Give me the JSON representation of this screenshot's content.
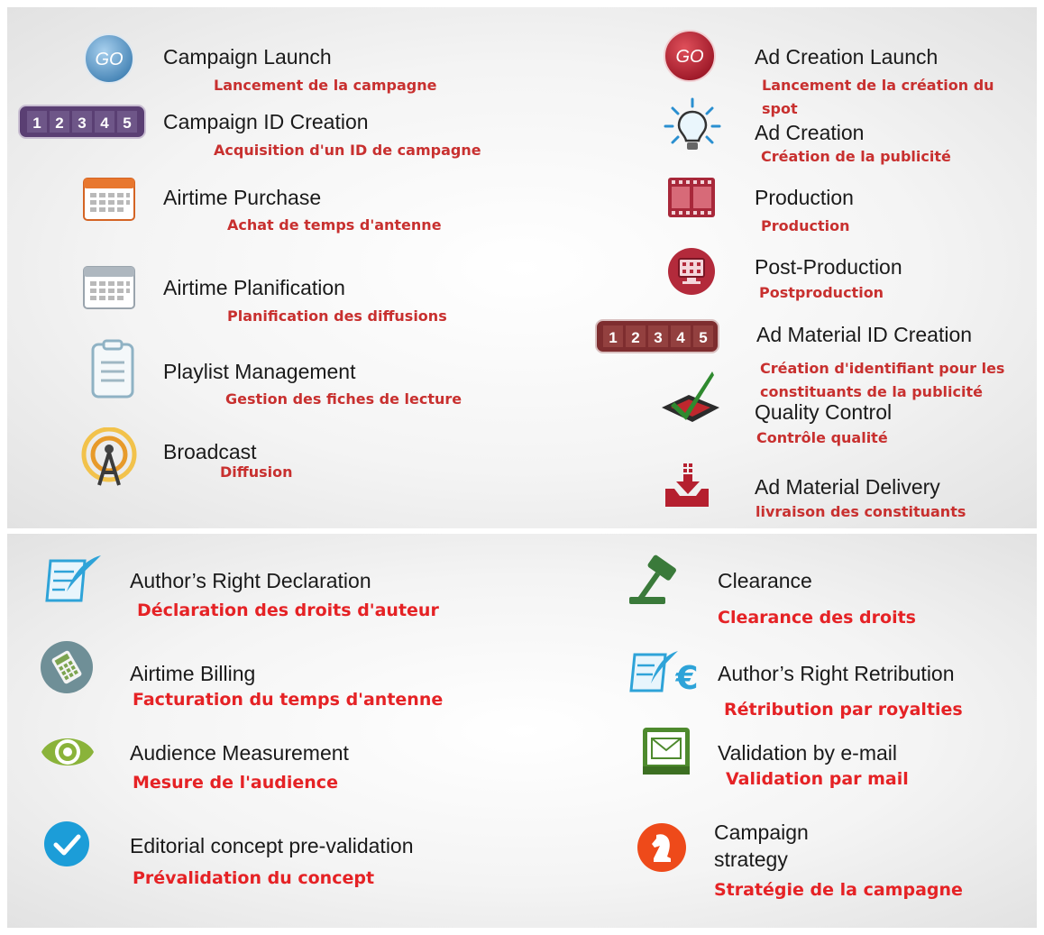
{
  "top_left": [
    {
      "en": "Campaign Launch",
      "fr": "Lancement de la campagne",
      "icon": "go-button-blue-icon"
    },
    {
      "en": "Campaign ID Creation",
      "fr": "Acquisition d'un ID de campagne",
      "icon": "id-counter-purple-icon",
      "digits": "1 2 3 4 5"
    },
    {
      "en": "Airtime Purchase",
      "fr": "Achat de temps d'antenne",
      "icon": "calendar-orange-icon"
    },
    {
      "en": "Airtime Planification",
      "fr": "Planification des diffusions",
      "icon": "calendar-grey-icon"
    },
    {
      "en": "Playlist Management",
      "fr": "Gestion des fiches de lecture",
      "icon": "clipboard-icon"
    },
    {
      "en": "Broadcast",
      "fr": "Diffusion",
      "icon": "broadcast-tower-icon"
    }
  ],
  "top_right": [
    {
      "en": "Ad Creation Launch",
      "fr": "Lancement de la création du spot",
      "icon": "go-button-red-icon"
    },
    {
      "en": "Ad Creation",
      "fr": "Création de la publicité",
      "icon": "lightbulb-icon"
    },
    {
      "en": "Production",
      "fr": "Production",
      "icon": "film-strip-icon"
    },
    {
      "en": "Post-Production",
      "fr": "Postproduction",
      "icon": "monitor-icon"
    },
    {
      "en": "Ad Material ID Creation",
      "fr": "Création d'identifiant pour les constituants de la publicité",
      "icon": "id-counter-red-icon",
      "digits": "1 2 3 4 5"
    },
    {
      "en": "Quality Control",
      "fr": "Contrôle qualité",
      "icon": "checkmark-icon"
    },
    {
      "en": "Ad Material Delivery",
      "fr": "livraison des constituants",
      "icon": "delivery-tray-icon"
    }
  ],
  "bottom_left": [
    {
      "en": "Author’s Right Declaration",
      "fr": "Déclaration des droits d'auteur",
      "icon": "quill-document-icon"
    },
    {
      "en": "Airtime Billing",
      "fr": "Facturation du temps d'antenne",
      "icon": "calculator-icon"
    },
    {
      "en": "Audience Measurement",
      "fr": "Mesure de l'audience",
      "icon": "eye-icon"
    },
    {
      "en": "Editorial concept pre-validation",
      "fr": "Prévalidation du concept",
      "icon": "check-circle-icon"
    }
  ],
  "bottom_right": [
    {
      "en": "Clearance",
      "fr": "Clearance des droits",
      "icon": "gavel-icon"
    },
    {
      "en": "Author’s Right Retribution",
      "fr": "Rétribution par royalties",
      "icon": "quill-euro-icon"
    },
    {
      "en": "Validation by e-mail",
      "fr": "Validation par mail",
      "icon": "envelope-icon"
    },
    {
      "en": "Campaign strategy",
      "fr": "Stratégie de la campagne",
      "icon": "chess-knight-icon"
    }
  ],
  "colors": {
    "fr_top": "#c8302f",
    "fr_bottom": "#e52225",
    "go_blue": "#5e9dc8",
    "go_red": "#b5202f",
    "id_purple": "#5a3f73",
    "id_red": "#7e2d2f",
    "check_green": "#2f8a2f",
    "eye_green": "#8ab33a",
    "envelope_green": "#4e8a2e",
    "gavel_green": "#3a7a3a",
    "quill_blue": "#2ea3d8",
    "check_circle_blue": "#1c9dd8",
    "knight_orange": "#ee4a1a"
  }
}
